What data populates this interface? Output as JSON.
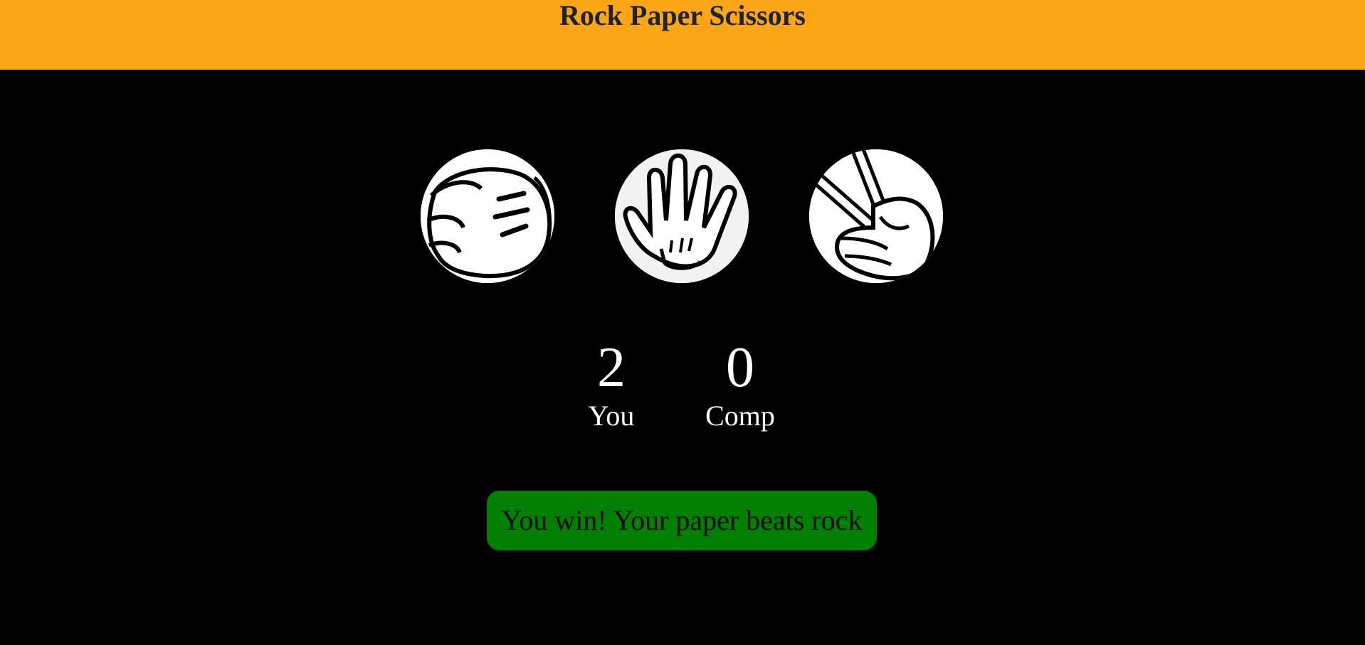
{
  "header": {
    "title": "Rock Paper Scissors",
    "background": "#fca516"
  },
  "choices": [
    {
      "id": "rock",
      "icon": "rock-fist-icon"
    },
    {
      "id": "paper",
      "icon": "paper-hand-icon"
    },
    {
      "id": "scissors",
      "icon": "scissors-hand-icon"
    }
  ],
  "scoreboard": {
    "user_score": "2",
    "user_label": "You",
    "comp_score": "0",
    "comp_label": "Comp"
  },
  "message": {
    "text": "You win! Your paper beats rock",
    "background": "#018001"
  }
}
